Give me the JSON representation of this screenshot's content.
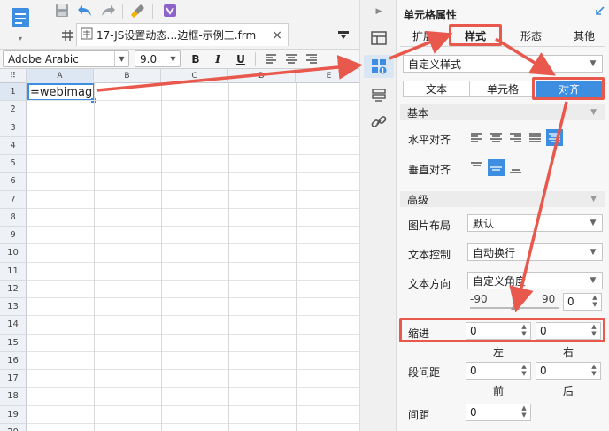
{
  "tab": {
    "title": "17-JS设置动态…边框-示例三.frm",
    "close": "×"
  },
  "format_bar": {
    "font": "Adobe Arabic",
    "size": "9.0",
    "bold": "B",
    "italic": "I",
    "underline": "U"
  },
  "grid": {
    "columns": [
      "A",
      "B",
      "C",
      "D",
      "E"
    ],
    "rows": [
      "1",
      "2",
      "3",
      "4",
      "5",
      "6",
      "7",
      "8",
      "9",
      "10",
      "11",
      "12",
      "13",
      "14",
      "15",
      "16",
      "17",
      "18",
      "19",
      "20"
    ],
    "cell_a1": "=webimag"
  },
  "panel": {
    "title": "单元格属性",
    "tabs": [
      "扩展",
      "样式",
      "形态",
      "其他"
    ],
    "style_select": "自定义样式",
    "segments": [
      "文本",
      "单元格",
      "对齐"
    ],
    "section_basic": "基本",
    "h_align_label": "水平对齐",
    "v_align_label": "垂直对齐",
    "section_advanced": "高级",
    "image_layout_label": "图片布局",
    "image_layout_value": "默认",
    "text_control_label": "文本控制",
    "text_control_value": "自动换行",
    "text_direction_label": "文本方向",
    "text_direction_value": "自定义角度",
    "angle_min": "-90",
    "angle_mid": "0",
    "angle_max": "90",
    "angle_value": "0",
    "indent_label": "缩进",
    "indent_left": "0",
    "indent_right": "0",
    "left_label": "左",
    "right_label": "右",
    "para_label": "段间距",
    "para_before": "0",
    "para_after": "0",
    "before_label": "前",
    "after_label": "后",
    "spacing_label": "间距",
    "spacing_value": "0"
  },
  "colors": {
    "accent": "#3d8ee0",
    "annotation": "#e8584c"
  }
}
